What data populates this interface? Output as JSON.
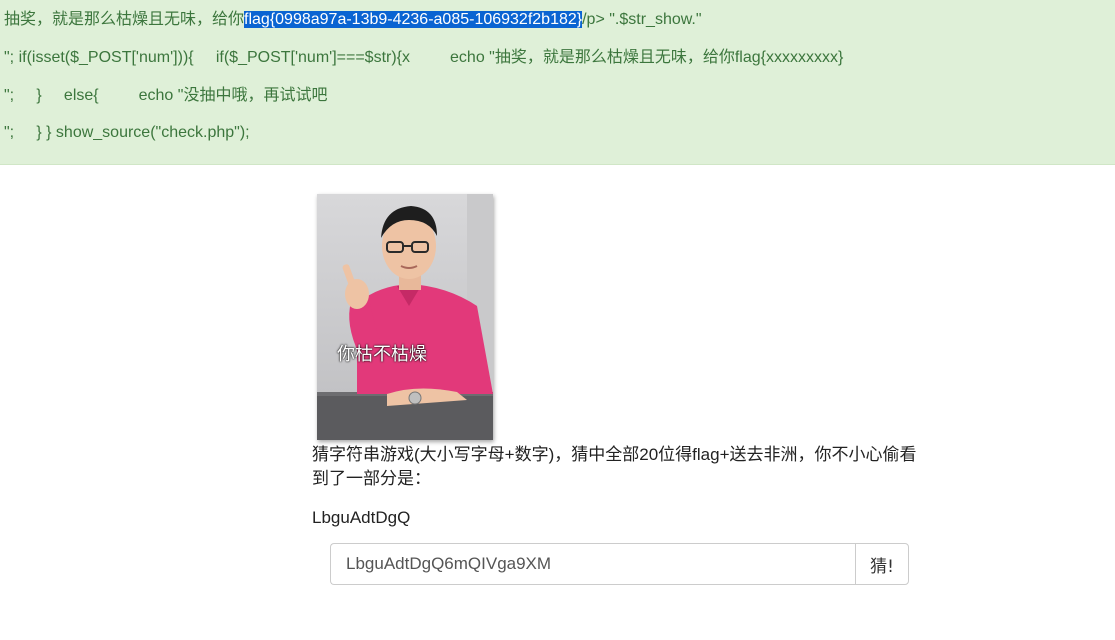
{
  "source": {
    "line1_pre": "抽奖，就是那么枯燥且无味，给你",
    "line1_selected": "flag{0998a97a-13b9-4236-a085-106932f2b182}",
    "line1_post": "/p> \".$str_show.\"",
    "line2": "\"; if(isset($_POST['num'])){     if($_POST['num']===$str){x         echo \"抽奖，就是那么枯燥且无味，给你flag{xxxxxxxxx}",
    "line3": "\";     }     else{         echo \"没抽中哦，再试试吧",
    "line4": "\";     } } show_source(\"check.php\");"
  },
  "meme": {
    "caption": "你枯不枯燥"
  },
  "game": {
    "description": "猜字符串游戏(大小写字母+数字)，猜中全部20位得flag+送去非洲，你不小心偷看到了一部分是：",
    "revealed": "LbguAdtDgQ"
  },
  "form": {
    "input_value": "LbguAdtDgQ6mQIVga9XM",
    "submit_label": "猜!"
  },
  "colors": {
    "banner_bg": "#dff0d8",
    "banner_text": "#3c763d",
    "selection": "#0a64d2",
    "shirt": "#e2397a"
  }
}
